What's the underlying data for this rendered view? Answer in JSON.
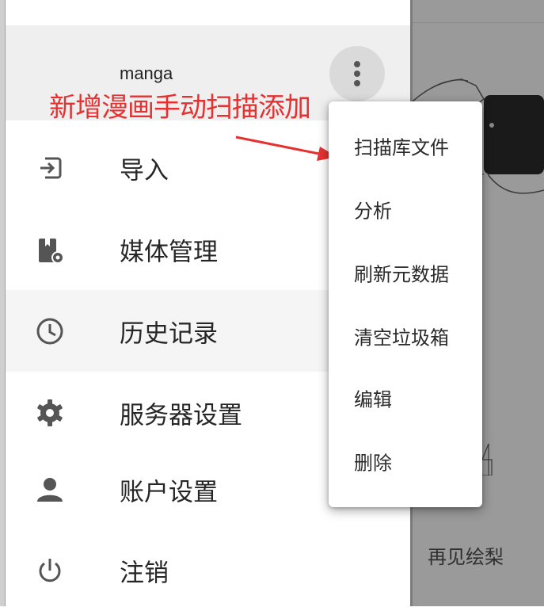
{
  "library": {
    "name": "manga",
    "more_icon": "more-vertical-icon"
  },
  "annotation": {
    "text": "新增漫画手动扫描添加",
    "color": "#e63131"
  },
  "nav": {
    "items": [
      {
        "label": "导入",
        "icon": "import-icon"
      },
      {
        "label": "媒体管理",
        "icon": "media-settings-icon"
      },
      {
        "label": "历史记录",
        "icon": "clock-icon"
      },
      {
        "label": "服务器设置",
        "icon": "gear-icon"
      },
      {
        "label": "账户设置",
        "icon": "person-icon"
      },
      {
        "label": "注销",
        "icon": "power-icon"
      }
    ]
  },
  "popup_menu": {
    "items": [
      {
        "label": "扫描库文件"
      },
      {
        "label": "分析"
      },
      {
        "label": "刷新元数据"
      },
      {
        "label": "清空垃圾箱"
      },
      {
        "label": "编辑"
      },
      {
        "label": "删除"
      }
    ]
  },
  "background": {
    "cover_title": "再见绘梨"
  },
  "colors": {
    "icon": "#555555",
    "header_bg": "#efefef",
    "backdrop": "#9a9a9a"
  }
}
